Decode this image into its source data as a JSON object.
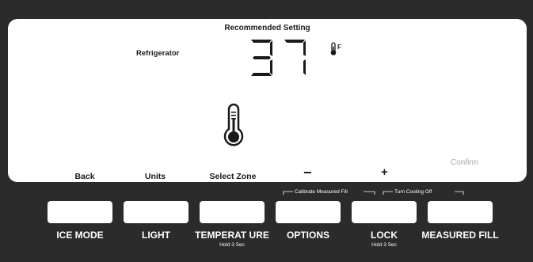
{
  "display": {
    "recommended_label": "Recommended Setting",
    "zone_label": "Refrigerator",
    "temperature": "37",
    "unit": "F",
    "confirm_label": "Confirm",
    "soft_buttons": {
      "back": "Back",
      "units": "Units",
      "select_zone": "Select Zone",
      "minus": "−",
      "plus": "+"
    }
  },
  "sub_labels": {
    "calibrate": "Calibrate Measured Fill",
    "turn_cooling_off": "Turn Cooling Off"
  },
  "hardware_buttons": [
    {
      "label": "ICE MODE",
      "hold": ""
    },
    {
      "label": "LIGHT",
      "hold": ""
    },
    {
      "label": "TEMPERAT URE",
      "hold": "Hold 3 Sec"
    },
    {
      "label": "OPTIONS",
      "hold": ""
    },
    {
      "label": "LOCK",
      "hold": "Hold 3 Sec"
    },
    {
      "label": "MEASURED FILL",
      "hold": ""
    }
  ],
  "colors": {
    "panel": "#2b2b2b",
    "display": "#ffffff",
    "text": "#1a1a1a",
    "confirm": "#a8a8a8"
  },
  "icons": {
    "unit": "thermometer-icon",
    "zone": "thermometer-icon"
  }
}
